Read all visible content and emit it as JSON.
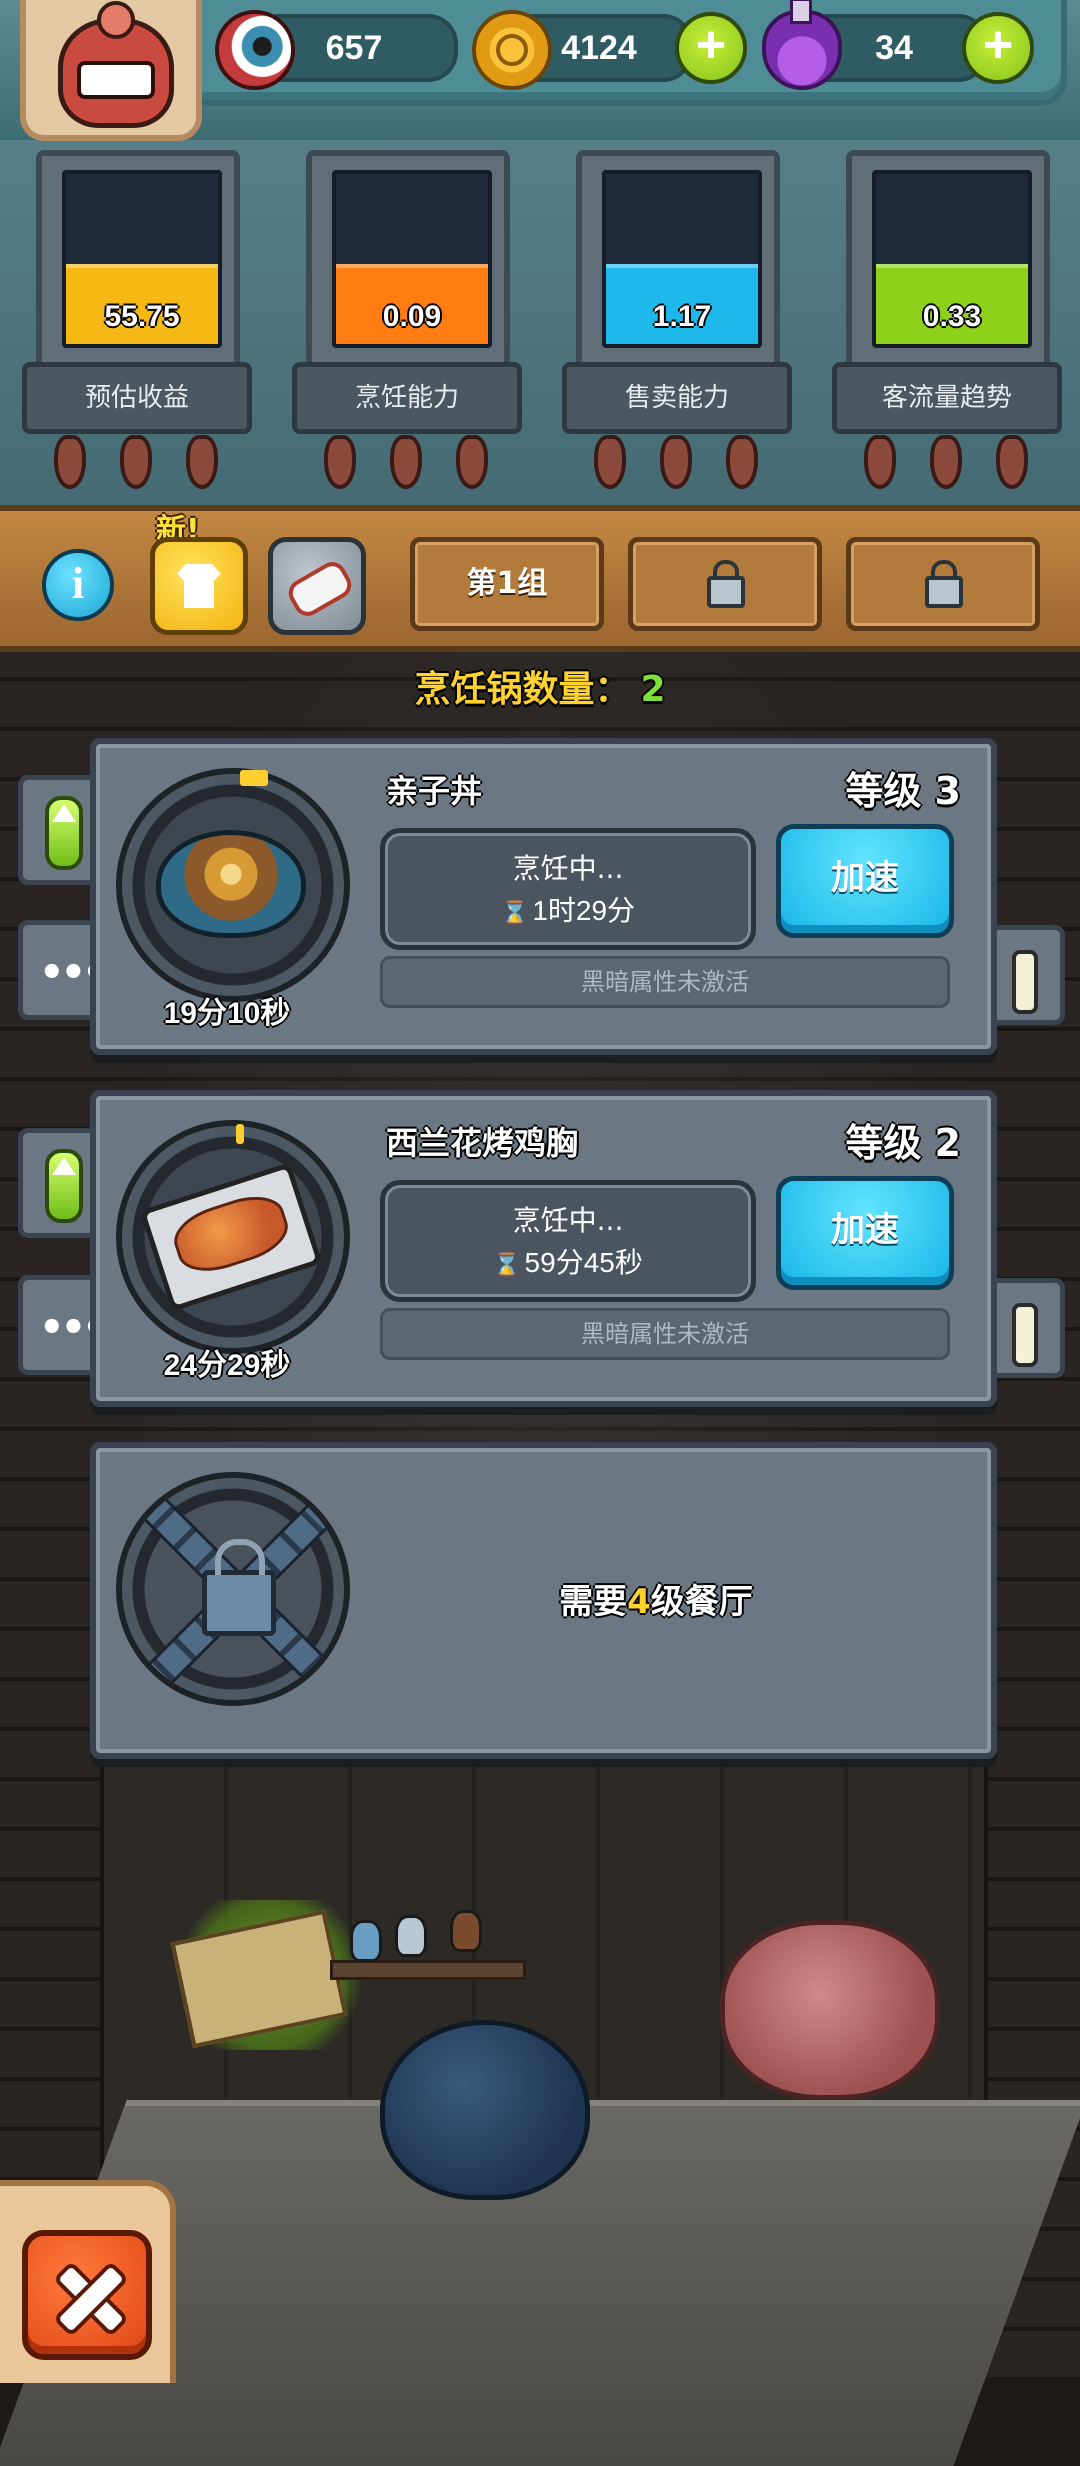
{
  "resources": {
    "eyes": "657",
    "coins": "4124",
    "potions": "34"
  },
  "stats": [
    {
      "value": "55.75",
      "label": "预估收益",
      "color": "#f5b814",
      "fill": 0.45
    },
    {
      "value": "0.09",
      "label": "烹饪能力",
      "color": "#ff7d12",
      "fill": 0.45
    },
    {
      "value": "1.17",
      "label": "售卖能力",
      "color": "#1eb8ea",
      "fill": 0.45
    },
    {
      "value": "0.33",
      "label": "客流量趋势",
      "color": "#8ed11a",
      "fill": 0.45
    }
  ],
  "tabs": {
    "new_badge": "新!",
    "group1": "第1组"
  },
  "pot_count": {
    "label": "烹饪锅数量：",
    "value": "2"
  },
  "pots": [
    {
      "name": "亲子丼",
      "level": "等级 3",
      "status": "烹饪中...",
      "remaining": "1时29分",
      "dish_timer": "19分10秒",
      "speed_label": "加速",
      "dark_attr": "黑暗属性未激活"
    },
    {
      "name": "西兰花烤鸡胸",
      "level": "等级 2",
      "status": "烹饪中...",
      "remaining": "59分45秒",
      "dish_timer": "24分29秒",
      "speed_label": "加速",
      "dark_attr": "黑暗属性未激活"
    }
  ],
  "locked_pot": {
    "prefix": "需要",
    "level": "4",
    "suffix": "级餐厅"
  },
  "colors": {
    "accent_yellow": "#ffd22e",
    "accent_green": "#7fe03a",
    "speed_blue": "#18b7e7"
  }
}
